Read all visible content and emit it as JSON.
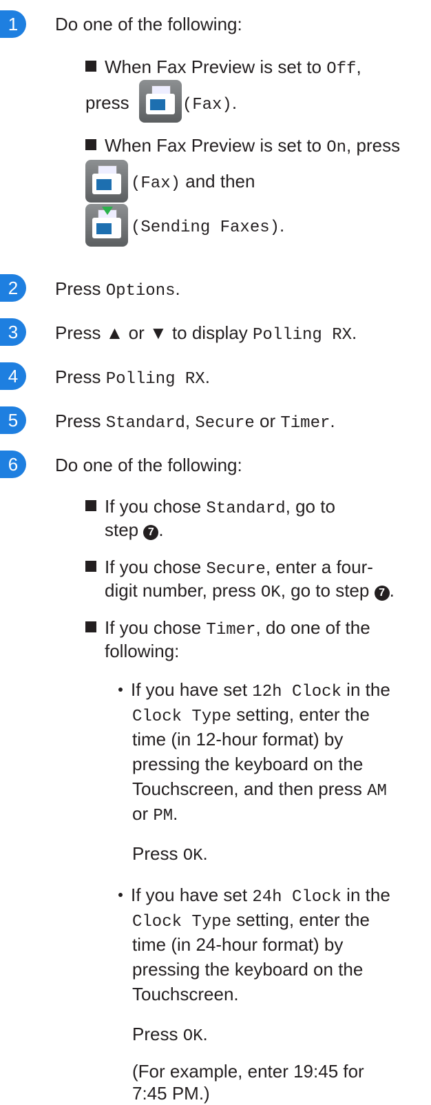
{
  "steps": {
    "s1": {
      "num": "1",
      "lead": "Do one of the following:"
    },
    "s2": {
      "num": "2",
      "press": "Press ",
      "code": "Options",
      "end": "."
    },
    "s3": {
      "num": "3",
      "text": "Press ▲ or ▼ to display ",
      "code": "Polling RX",
      "end": "."
    },
    "s4": {
      "num": "4",
      "press": "Press ",
      "code": "Polling RX",
      "end": "."
    },
    "s5": {
      "num": "5",
      "press": "Press ",
      "c1": "Standard",
      "sep1": ", ",
      "c2": "Secure",
      "sep2": " or ",
      "c3": "Timer",
      "end": "."
    },
    "s6": {
      "num": "6",
      "lead": "Do one of the following:"
    }
  },
  "b1": {
    "l1a": "When Fax Preview is set to ",
    "l1c": "Off",
    "l1e": ",",
    "l2a": "press ",
    "l2c": "(Fax)",
    "l2e": "."
  },
  "b2": {
    "l1a": "When Fax Preview is set to ",
    "l1c": "On",
    "l1e": ", press",
    "l2c": "(Fax)",
    "l2e": " and then",
    "l3c": "(Sending Faxes)",
    "l3e": "."
  },
  "b3": {
    "a": "If you chose ",
    "c": "Standard",
    "e": ", go to",
    "l2": "step ",
    "ref": "7",
    "l2e": "."
  },
  "b4": {
    "a": "If you chose ",
    "c": "Secure",
    "e": ", enter a four-",
    "l2a": "digit number, press ",
    "l2c": "OK",
    "l2e": ", go to step ",
    "ref": "7",
    "end": "."
  },
  "b5": {
    "a": "If you chose ",
    "c": "Timer",
    "e": ", do one of the",
    "l2": "following:"
  },
  "sub1": {
    "l1a": "If you have set ",
    "l1c": "12h Clock",
    "l1e": " in the",
    "l2c": "Clock Type",
    "l2e": " setting, enter the",
    "l3": "time (in 12-hour format) by",
    "l4": "pressing the keyboard on the",
    "l5a": "Touchscreen, and then press ",
    "l5c": "AM",
    "l6a": "or ",
    "l6c": "PM",
    "l6e": ".",
    "okA": "Press ",
    "okC": "OK",
    "okE": "."
  },
  "sub2": {
    "l1a": "If you have set ",
    "l1c": "24h Clock",
    "l1e": " in the",
    "l2c": "Clock Type",
    "l2e": " setting, enter the",
    "l3": "time (in 24-hour format) by",
    "l4": "pressing the keyboard on the",
    "l5": "Touchscreen.",
    "okA": "Press ",
    "okC": "OK",
    "okE": ".",
    "ex1": "(For example, enter 19:45 for",
    "ex2": "7:45 PM.)"
  }
}
